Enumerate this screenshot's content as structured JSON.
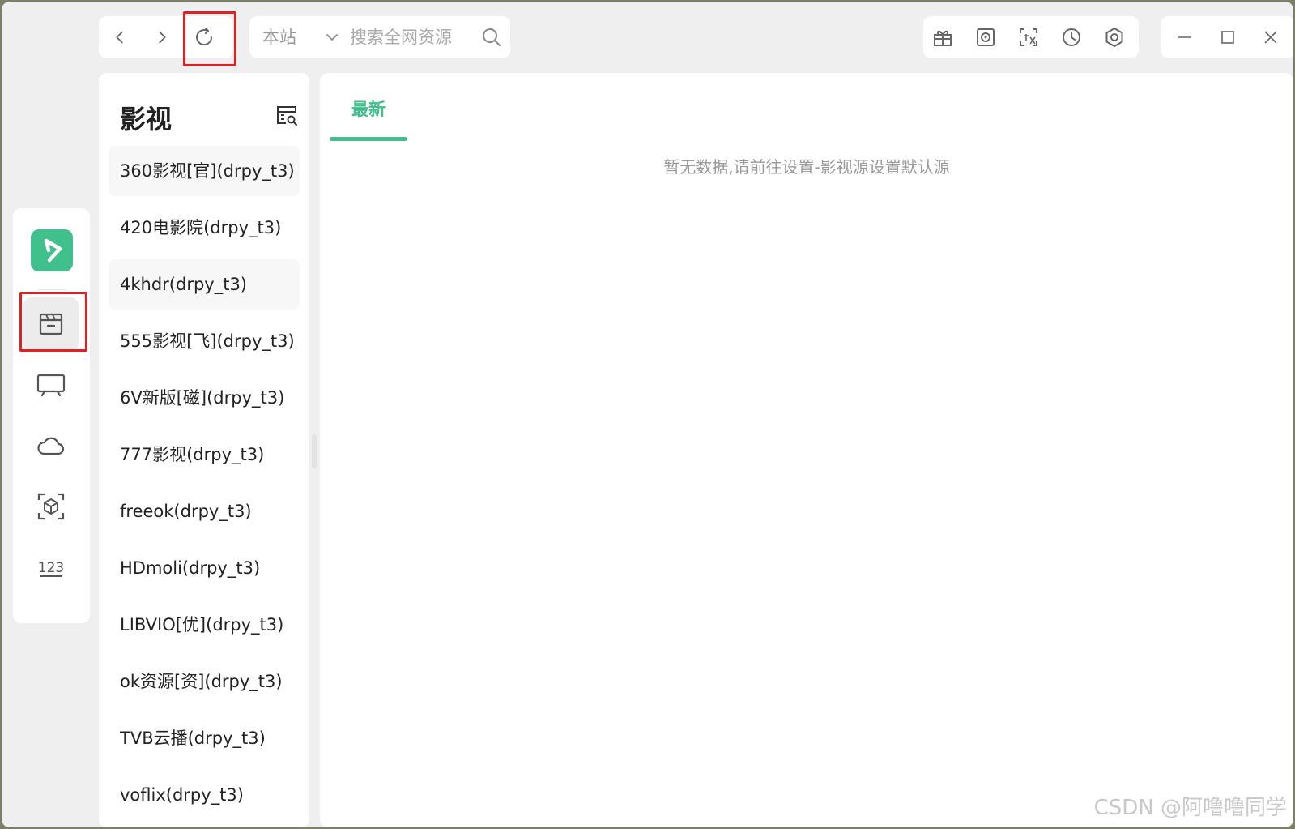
{
  "search": {
    "scope": "本站",
    "placeholder": "搜索全网资源"
  },
  "sidebar": {
    "title": "影视",
    "sources": [
      "360影视[官](drpy_t3)",
      "420电影院(drpy_t3)",
      "4khdr(drpy_t3)",
      "555影视[飞](drpy_t3)",
      "6V新版[磁](drpy_t3)",
      "777影视(drpy_t3)",
      "freeok(drpy_t3)",
      "HDmoli(drpy_t3)",
      "LIBVIO[优](drpy_t3)",
      "ok资源[资](drpy_t3)",
      "TVB云播(drpy_t3)",
      "voflix(drpy_t3)"
    ]
  },
  "main": {
    "tabs": [
      {
        "label": "最新"
      }
    ],
    "empty_message": "暂无数据,请前往设置-影视源设置默认源"
  },
  "watermark": "CSDN @阿噜噜同学",
  "colors": {
    "accent": "#3fc08c",
    "highlight": "#e02020"
  },
  "icons": {
    "nav": [
      "chevron-left-icon",
      "chevron-right-icon",
      "refresh-icon"
    ],
    "tools": [
      "gift-icon",
      "record-icon",
      "translate-icon",
      "history-icon",
      "settings-icon"
    ],
    "rail": [
      "app-logo-icon",
      "film-icon",
      "tv-icon",
      "cloud-icon",
      "cube-icon",
      "number-123-icon"
    ]
  }
}
